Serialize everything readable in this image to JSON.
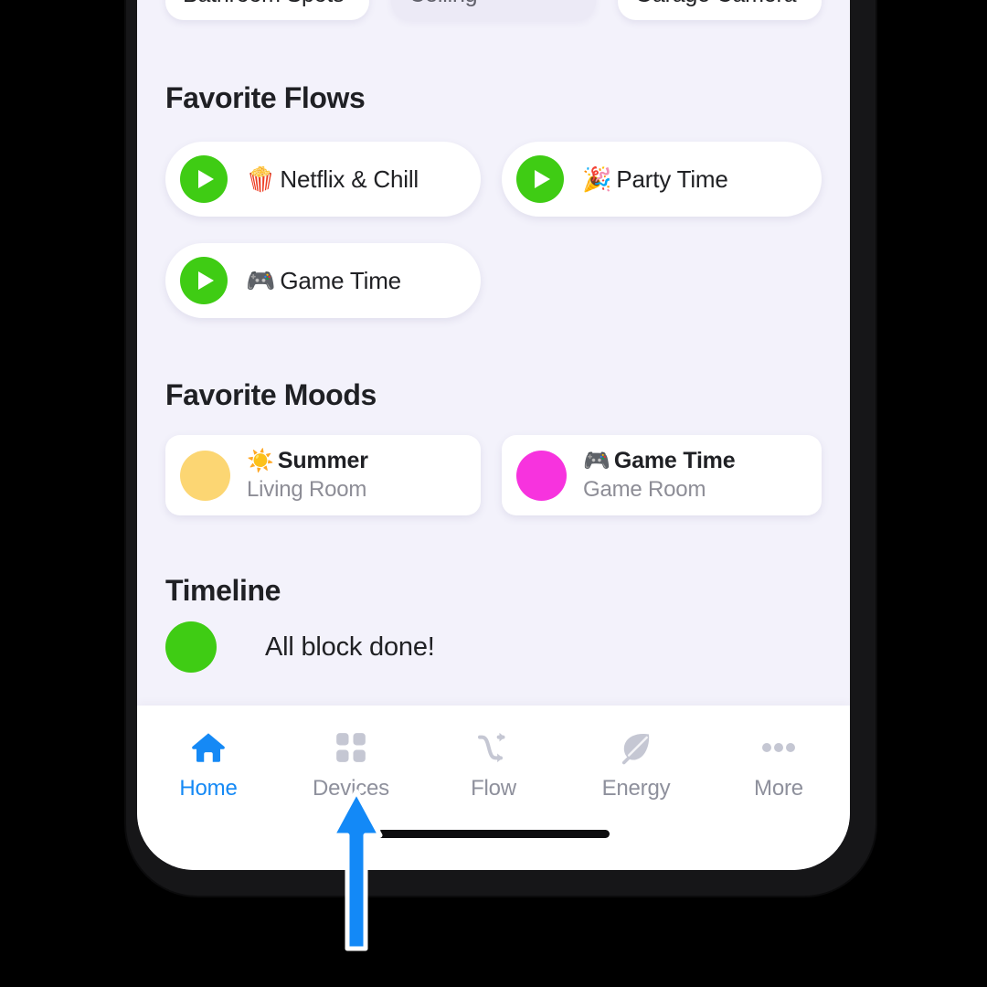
{
  "app": {
    "screen_name": "Homey Home",
    "background_color": "#f3f2fb",
    "accent_blue": "#1589f5",
    "flow_green": "#3fcc14"
  },
  "devices_strip": {
    "cards": [
      {
        "label": "Bathroom Spots",
        "state": "on"
      },
      {
        "label": "Ceiling",
        "state": "off"
      },
      {
        "label": "Garage Camera",
        "state": "on"
      }
    ]
  },
  "favorite_flows": {
    "title": "Favorite Flows",
    "items": [
      {
        "emoji": "🍿",
        "label": "Netflix & Chill",
        "play_icon": "play-icon"
      },
      {
        "emoji": "🎉",
        "label": "Party Time",
        "play_icon": "play-icon"
      },
      {
        "emoji": "🎮",
        "label": "Game Time",
        "play_icon": "play-icon"
      }
    ]
  },
  "favorite_moods": {
    "title": "Favorite Moods",
    "items": [
      {
        "emoji": "☀️",
        "name": "Summer",
        "room": "Living Room",
        "color": "#fcd673"
      },
      {
        "emoji": "🎮",
        "name": "Game Time",
        "room": "Game Room",
        "color": "#f733de"
      }
    ]
  },
  "timeline": {
    "title": "Timeline",
    "entries": [
      {
        "text": "All block done!",
        "dot_color": "#3fcc14"
      }
    ]
  },
  "bottom_nav": {
    "items": [
      {
        "label": "Home",
        "icon": "home-icon",
        "active": true
      },
      {
        "label": "Devices",
        "icon": "grid-icon",
        "active": false
      },
      {
        "label": "Flow",
        "icon": "shuffle-arrows-icon",
        "active": false
      },
      {
        "label": "Energy",
        "icon": "leaf-icon",
        "active": false
      },
      {
        "label": "More",
        "icon": "ellipsis-icon",
        "active": false
      }
    ]
  },
  "annotation": {
    "type": "arrow-up",
    "points_at": "Devices",
    "color": "#1389f7"
  }
}
